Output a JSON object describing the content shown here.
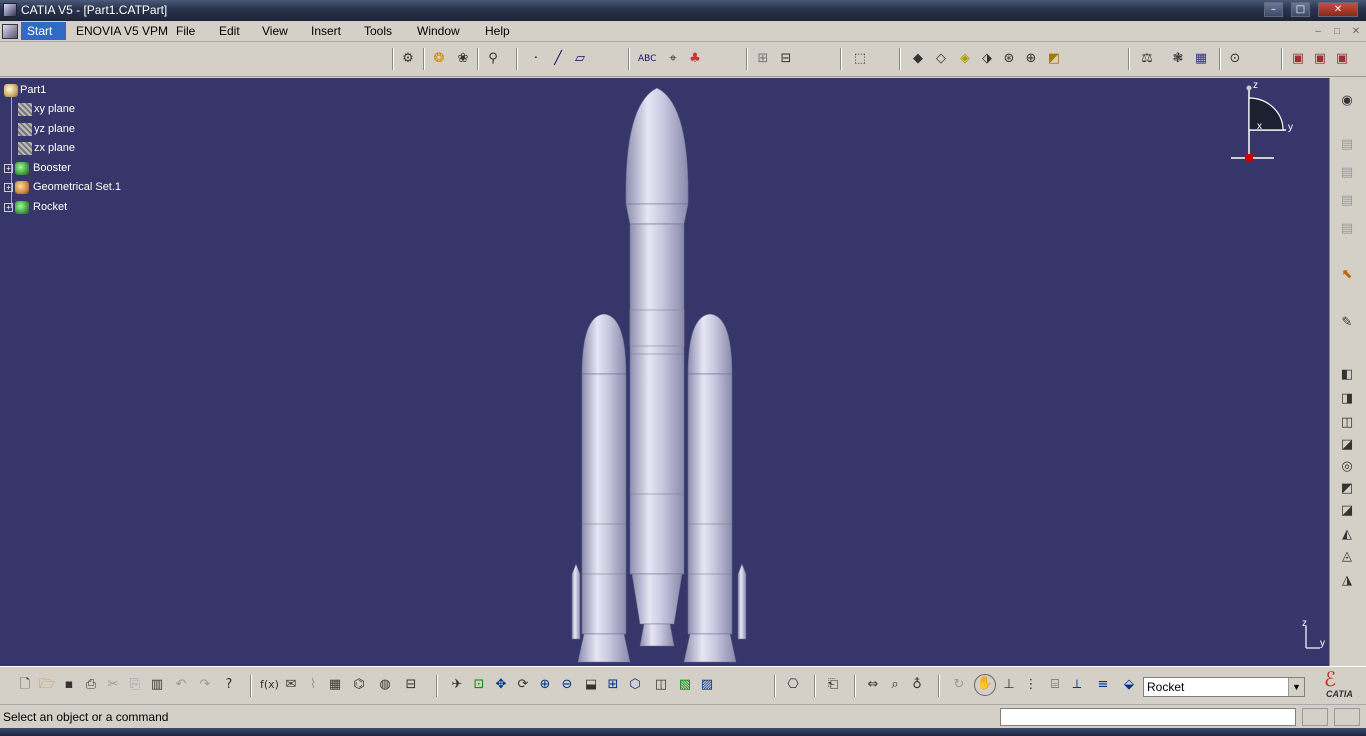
{
  "window": {
    "title": "CATIA V5 - [Part1.CATPart]",
    "min": "–",
    "max": "□",
    "close": "✕"
  },
  "menu": {
    "start": "Start",
    "enovia": "ENOVIA V5 VPM",
    "file": "File",
    "edit": "Edit",
    "view": "View",
    "insert": "Insert",
    "tools": "Tools",
    "window": "Window",
    "help": "Help"
  },
  "tree": {
    "root": "Part1",
    "items": [
      "xy plane",
      "yz plane",
      "zx plane",
      "Booster",
      "Geometrical Set.1",
      "Rocket"
    ]
  },
  "compass": {
    "z": "z",
    "y": "y",
    "x": "x"
  },
  "triad": {
    "z": "z",
    "y": "y"
  },
  "status": {
    "message": "Select an object or a command"
  },
  "combo": {
    "value": "Rocket"
  },
  "logo": {
    "text": "CATIA"
  },
  "colors": {
    "viewport": "#36366a",
    "rocket": "#c8c8e0",
    "selection": "#316ac5"
  }
}
